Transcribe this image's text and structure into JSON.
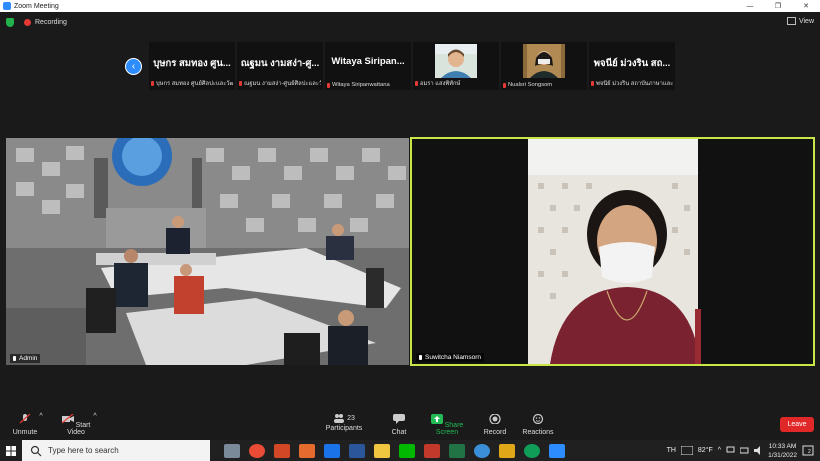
{
  "window": {
    "title": "Zoom Meeting"
  },
  "meeting": {
    "recording_label": "Recording",
    "view_label": "View"
  },
  "gallery": {
    "thumbs": [
      {
        "display": "บุษกร สมทอง ศูน...",
        "name": "บุษกร สมทอง ศูนย์ศิลปะและวัฒนธรรม"
      },
      {
        "display": "ณฐมน งามสง่า-ศู...",
        "name": "ณฐมน งามสง่า-ศูนย์ศิลปะและวัฒนธรรม"
      },
      {
        "display": "Witaya Siripan...",
        "name": "Witaya Siripanwattana"
      },
      {
        "display": "",
        "name": "อมรา แสงพิทักษ์"
      },
      {
        "display": "",
        "name": "Nualsri Songsom"
      },
      {
        "display": "พจนีย์ ม่วงริน สถ...",
        "name": "พจนีย์ ม่วงริน สถาบันภาษาและวัฒนธรรม"
      }
    ]
  },
  "videos": {
    "left_name": "Admin",
    "right_name": "Suwitcha Niamsorn"
  },
  "toolbar": {
    "unmute": "Unmute",
    "start_video": "Start Video",
    "participants": "Participants",
    "participants_count": "23",
    "chat": "Chat",
    "share_screen": "Share Screen",
    "record": "Record",
    "reactions": "Reactions",
    "leave": "Leave"
  },
  "taskbar": {
    "search_placeholder": "Type here to search",
    "lang": "TH",
    "temperature": "82°F",
    "time": "10:33 AM",
    "date": "1/31/2022",
    "notifications": "2"
  },
  "colors": {
    "accent": "#2d8cff",
    "leave": "#e02828",
    "active_border": "#c8e645",
    "share": "#22bb55"
  }
}
